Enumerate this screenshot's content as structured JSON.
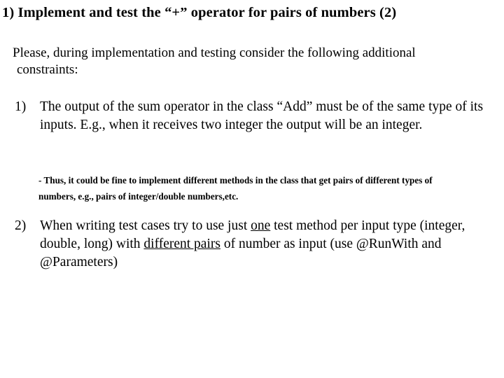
{
  "slide": {
    "title": "1) Implement and test the “+” operator for pairs of numbers (2)",
    "intro": {
      "line1": "Please, during implementation and testing consider the following additional",
      "line2": "constraints:"
    },
    "items": [
      {
        "marker": "1)",
        "text": "The output of the sum operator in the class “Add” must be of the same type of its inputs. E.g., when it receives two integer the output will be an integer."
      },
      {
        "marker": "2)",
        "text_part1": "When writing test cases try to use just ",
        "underline1": "one",
        "text_part2": " test method per input type (integer, double, long) with ",
        "underline2": "different pairs",
        "text_part3": " of number as input (use @RunWith and @Parameters)"
      }
    ],
    "subnote": "- Thus, it could be fine to implement different methods in the class that get pairs of different types of numbers, e.g., pairs of integer/double numbers,etc.",
    "colors": {
      "background": "#ffffff",
      "text": "#000000"
    }
  }
}
